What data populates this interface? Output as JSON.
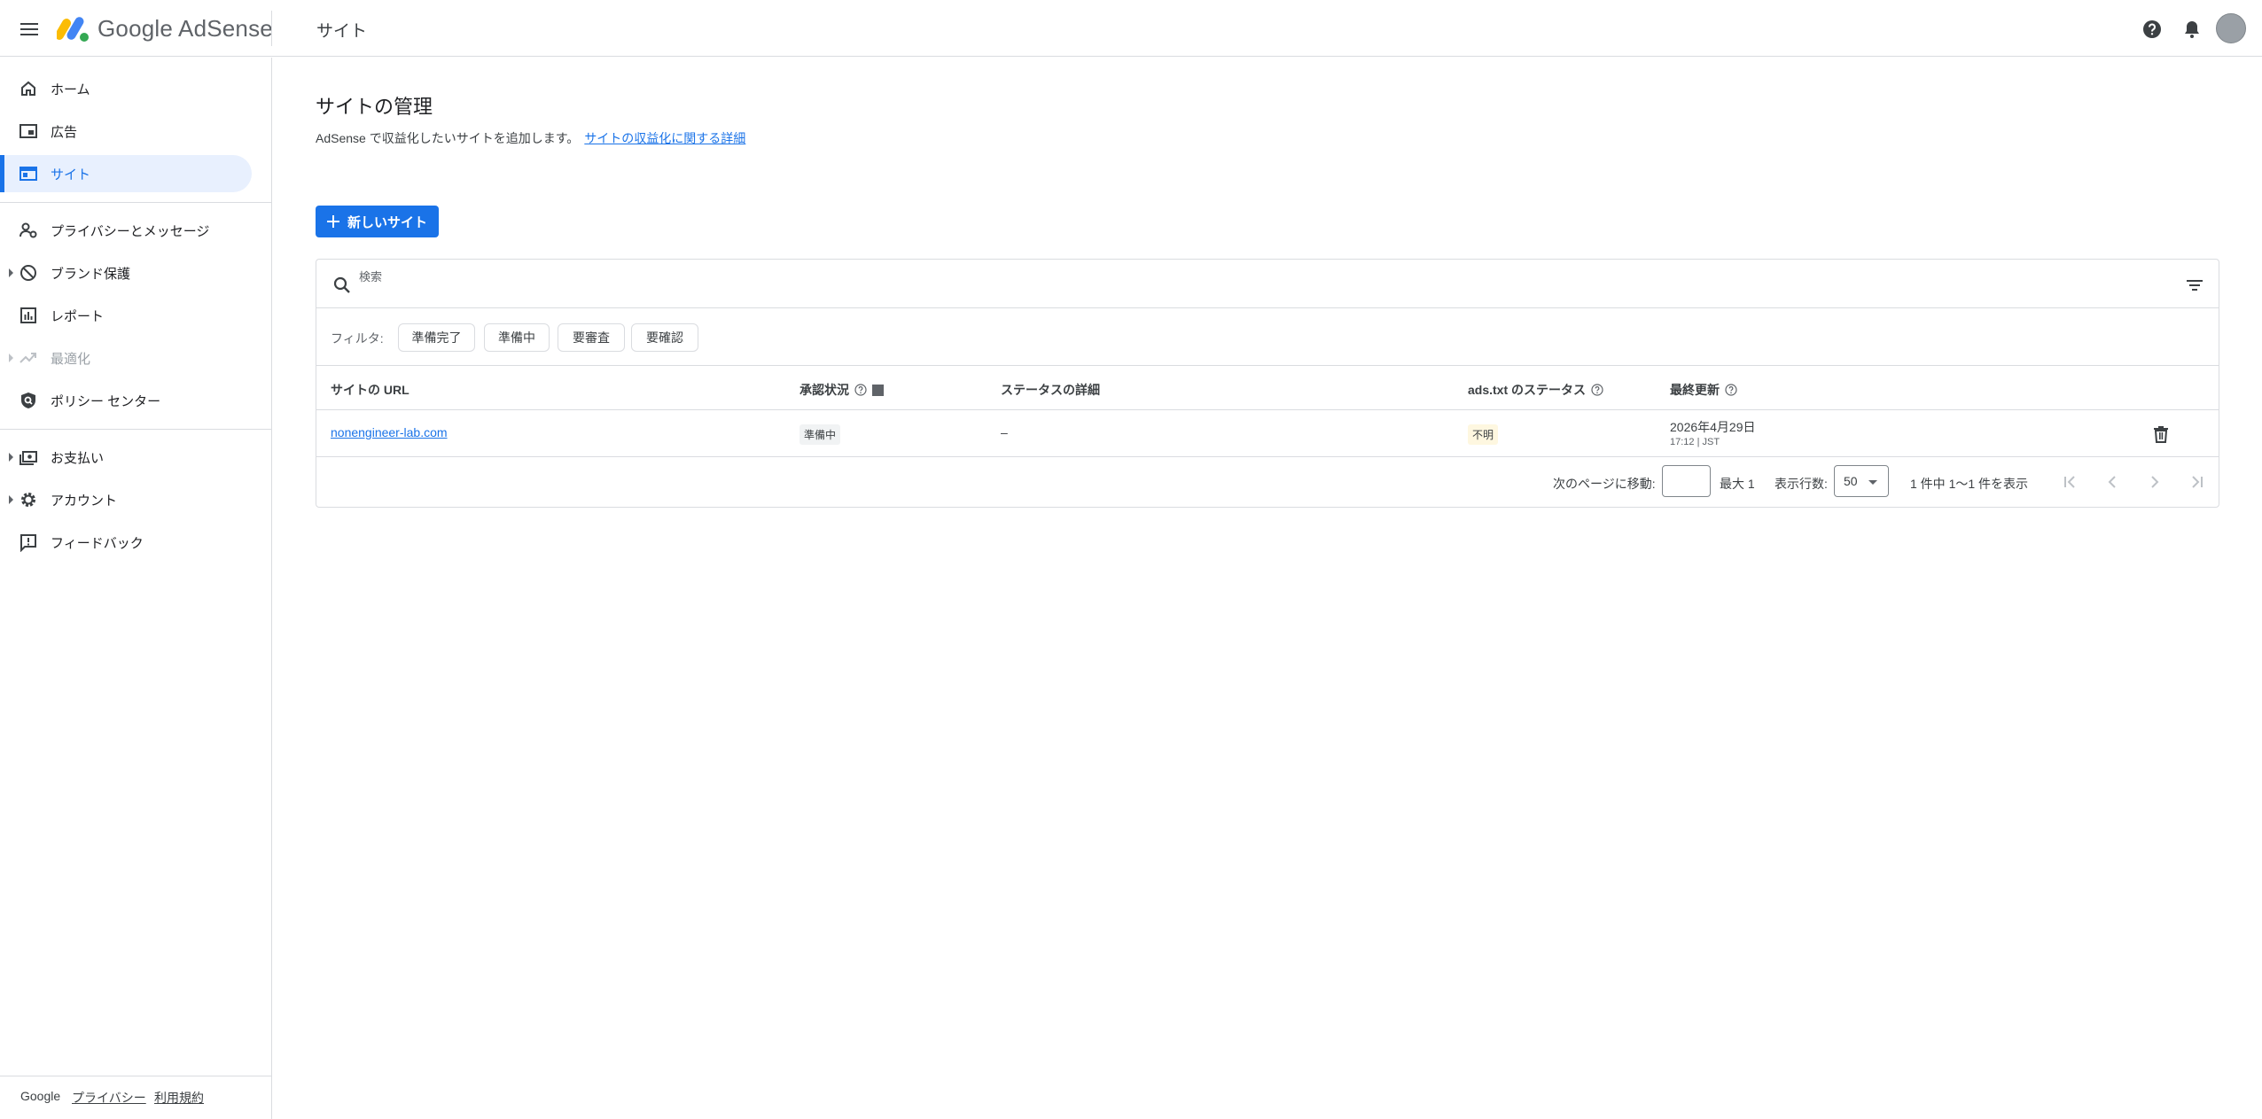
{
  "header": {
    "product_name": "Google AdSense",
    "page_title": "サイト"
  },
  "sidebar": {
    "items": [
      {
        "label": "ホーム",
        "icon": "home-icon"
      },
      {
        "label": "広告",
        "icon": "ads-icon"
      },
      {
        "label": "サイト",
        "icon": "sites-icon",
        "active": true
      },
      {
        "label": "プライバシーとメッセージ",
        "icon": "privacy-messaging-icon"
      },
      {
        "label": "ブランド保護",
        "icon": "block-icon",
        "expandable": true
      },
      {
        "label": "レポート",
        "icon": "reports-icon"
      },
      {
        "label": "最適化",
        "icon": "trending-up-icon",
        "expandable": true,
        "disabled": true
      },
      {
        "label": "ポリシー センター",
        "icon": "policy-shield-icon"
      },
      {
        "label": "お支払い",
        "icon": "payments-icon",
        "expandable": true
      },
      {
        "label": "アカウント",
        "icon": "settings-icon",
        "expandable": true
      },
      {
        "label": "フィードバック",
        "icon": "feedback-icon"
      }
    ],
    "footer": {
      "brand": "Google",
      "privacy": "プライバシー",
      "terms": "利用規約"
    }
  },
  "main": {
    "title": "サイトの管理",
    "description": "AdSense で収益化したいサイトを追加します。",
    "learn_more": "サイトの収益化に関する詳細",
    "new_site_button": "新しいサイト",
    "search_placeholder": "検索",
    "filter_label": "フィルタ:",
    "chips": [
      "準備完了",
      "準備中",
      "要審査",
      "要確認"
    ],
    "table": {
      "columns": [
        "サイトの URL",
        "承認状況",
        "ステータスの詳細",
        "ads.txt のステータス",
        "最終更新"
      ],
      "rows": [
        {
          "url": "nonengineer-lab.com",
          "approval": "準備中",
          "detail": "–",
          "ads_txt": "不明",
          "updated_date": "2026年4月29日",
          "updated_time": "17:12 | JST"
        }
      ]
    },
    "pagination": {
      "goto_label": "次のページに移動:",
      "max_label": "最大 1",
      "rows_label": "表示行数:",
      "rows_value": "50",
      "range_label": "1 件中 1〜1 件を表示"
    }
  },
  "colors": {
    "accent": "#1a73e8",
    "active_bg": "#e8f0fe",
    "divider": "#dadce0"
  }
}
